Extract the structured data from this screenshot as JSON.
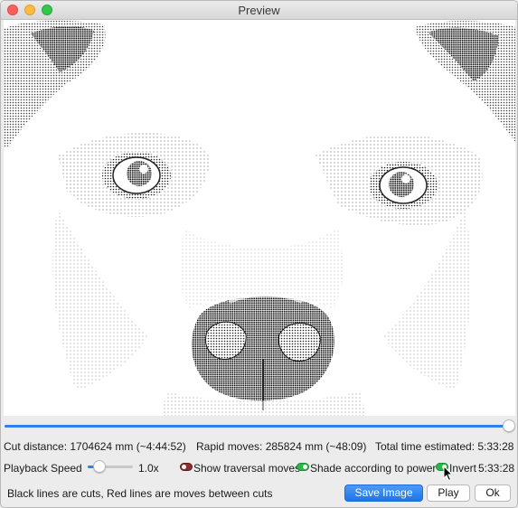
{
  "window": {
    "title": "Preview"
  },
  "stats": {
    "cut_distance": "Cut distance: 1704624 mm (~4:44:52)",
    "rapid_moves": "Rapid moves: 285824 mm (~48:09)",
    "total_time": "Total time estimated: 5:33:28"
  },
  "playback": {
    "label": "Playback Speed",
    "speed_value": "1.0x",
    "speed_fraction": 0.25,
    "progress_fraction": 1.0
  },
  "options": {
    "show_traversal": {
      "label": "Show traversal moves",
      "enabled": false
    },
    "shade_power": {
      "label": "Shade according to power",
      "enabled": true
    },
    "invert": {
      "label": "Invert",
      "enabled": true
    }
  },
  "elapsed_time": "5:33:28",
  "legend_text": "Black lines are cuts, Red lines are moves between cuts",
  "buttons": {
    "save": "Save Image",
    "play": "Play",
    "ok": "Ok"
  },
  "colors": {
    "accent": "#2f7ff0",
    "toggle_on": "#2bb84a",
    "toggle_off": "#8a2e2e"
  }
}
